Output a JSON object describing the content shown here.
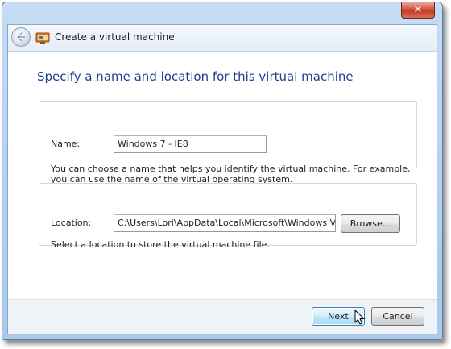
{
  "window": {
    "close_label": "✕"
  },
  "nav": {
    "title": "Create a virtual machine",
    "back_icon": "back-arrow-icon",
    "app_icon": "virtual-machine-icon"
  },
  "page": {
    "heading": "Specify a name and location for this virtual machine"
  },
  "name_section": {
    "label": "Name:",
    "value": "Windows 7 - IE8",
    "help_line1": "You can choose a name that helps you identify the virtual machine. For example,",
    "help_line2": "you can use the name of the virtual operating system."
  },
  "location_section": {
    "label": "Location:",
    "value": "C:\\Users\\Lori\\AppData\\Local\\Microsoft\\Windows Vir",
    "browse_label": "Browse...",
    "help": "Select a location to store the virtual machine file."
  },
  "footer": {
    "next_label": "Next",
    "cancel_label": "Cancel"
  },
  "colors": {
    "heading": "#1f3f8e",
    "close_button": "#c43b22",
    "default_button_border": "#3c7fb1"
  }
}
